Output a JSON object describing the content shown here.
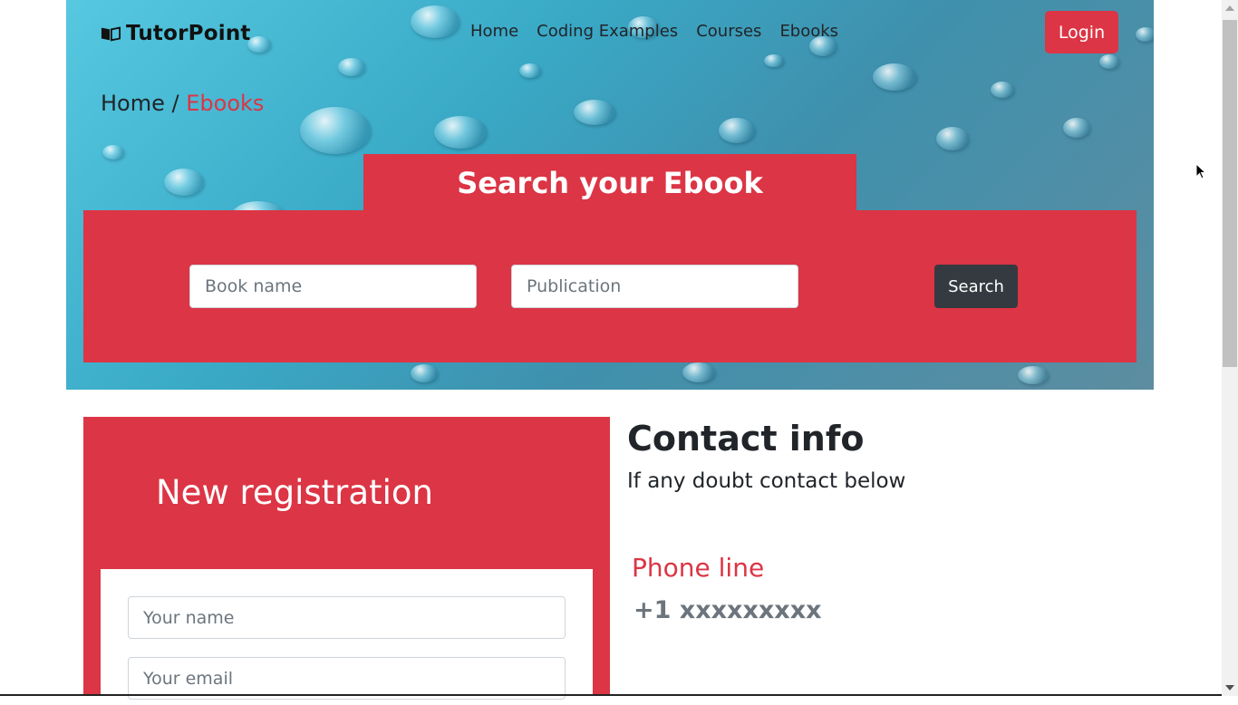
{
  "header": {
    "brand": "TutorPoint",
    "brand_icon": "open-book-icon",
    "nav": [
      {
        "label": "Home"
      },
      {
        "label": "Coding Examples"
      },
      {
        "label": "Courses"
      },
      {
        "label": "Ebooks"
      }
    ],
    "login_label": "Login"
  },
  "breadcrumb": {
    "home": "Home",
    "separator": "/",
    "current": "Ebooks"
  },
  "search": {
    "title": "Search your Ebook",
    "book_placeholder": "Book name",
    "publication_placeholder": "Publication",
    "button_label": "Search"
  },
  "registration": {
    "title": "New registration",
    "name_placeholder": "Your name",
    "email_placeholder": "Your email"
  },
  "contact": {
    "title": "Contact info",
    "subtitle": "If any doubt contact below",
    "phone_label": "Phone line",
    "phone_value": "+1 xxxxxxxxx"
  },
  "colors": {
    "accent": "#dc3545",
    "dark_button": "#343a40",
    "muted_text": "#6c757d"
  }
}
